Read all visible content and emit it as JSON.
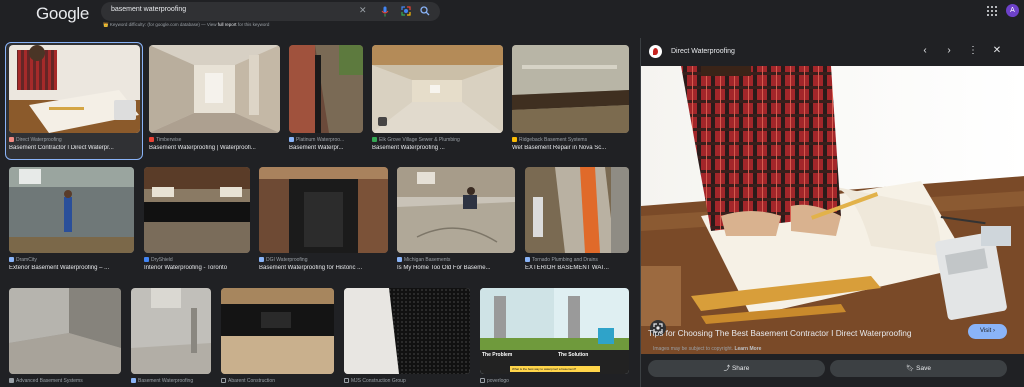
{
  "header": {
    "logo": "Google",
    "search_value": "basement waterproofing",
    "kd_prefix": "Keyword difficulty:",
    "kd_db": "(for google.com database) — View",
    "kd_link": "full report",
    "kd_suffix": "for this keyword",
    "avatar_letter": "A"
  },
  "results": [
    {
      "source": "Direct Waterproofing",
      "title": "Basement Contractor I Direct Waterpr..."
    },
    {
      "source": "Timberwise",
      "title": "Basement Waterproofing | Waterproofi..."
    },
    {
      "source": "Platinum Waterproo...",
      "title": "Basement Waterpr..."
    },
    {
      "source": "Elk Grove Village Sewer & Plumbing",
      "title": "Basement Waterproofing ..."
    },
    {
      "source": "Ridgeback Basement Systems",
      "title": "Wet Basement Repair in Nova Sc..."
    },
    {
      "source": "DramCity",
      "title": "Exterior Basement Waterproofing – ..."
    },
    {
      "source": "DryShield",
      "title": "Interior Waterproofing - Toronto"
    },
    {
      "source": "DGI Waterproofing",
      "title": "Basement Waterproofing for Historic ..."
    },
    {
      "source": "Michigan Basements",
      "title": "Is My Home Too Old For Baseme..."
    },
    {
      "source": "Tornado Plumbing and Drains",
      "title": "EXTERIOR BASEMENT WAT..."
    },
    {
      "source": "Advanced Basement Systems",
      "title": ""
    },
    {
      "source": "Basement Waterproofing",
      "title": ""
    },
    {
      "source": "Abarent Construction",
      "title": ""
    },
    {
      "source": "MJS Construction Group",
      "title": ""
    },
    {
      "source": "poverlogo",
      "title": ""
    }
  ],
  "diagram_labels": {
    "problem": "The Problem",
    "solution": "The Solution",
    "caption": "What is the best way to waterproof a basement?"
  },
  "panel": {
    "site": "Direct Waterproofing",
    "title": "Tips for Choosing The Best Basement Contractor I Direct Waterproofing",
    "visit_label": "Visit",
    "copyright": "Images may be subject to copyright.",
    "learn_more": "Learn More",
    "share_label": "Share",
    "save_label": "Save"
  }
}
